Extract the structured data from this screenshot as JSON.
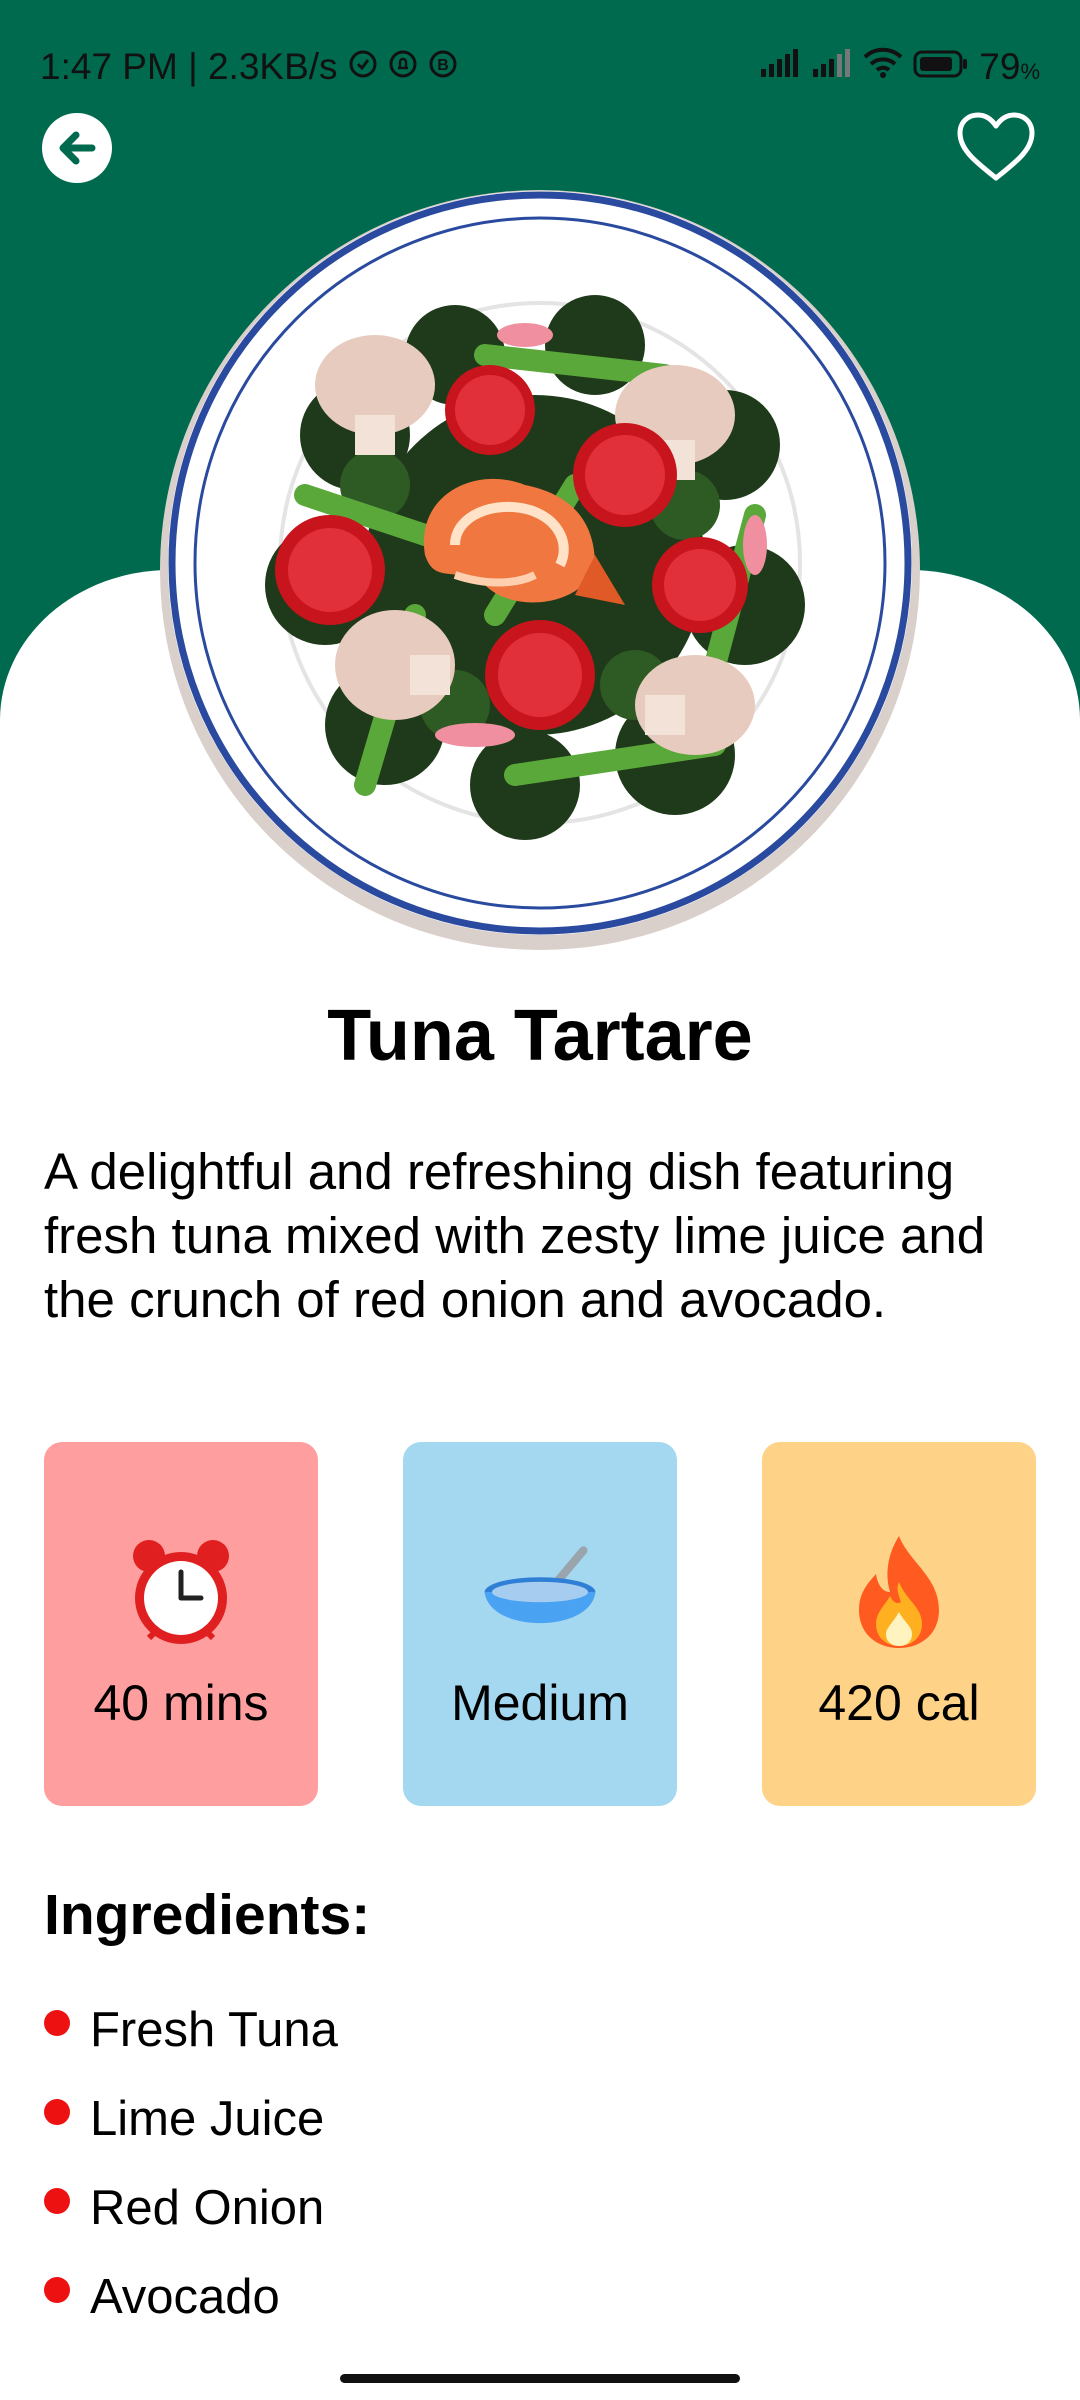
{
  "status_bar": {
    "time_and_speed": "1:47 PM | 2.3KB/s",
    "battery_percent": "79",
    "battery_unit": "%"
  },
  "header": {
    "back_icon": "arrow-left-icon",
    "favorite_icon": "heart-outline-icon"
  },
  "recipe": {
    "image_icon": "salad-bowl-illustration",
    "title": "Tuna Tartare",
    "description": "A delightful and refreshing dish featuring fresh tuna mixed with zesty lime juice and the crunch of red onion and avocado."
  },
  "info_cards": [
    {
      "icon": "alarm-clock-icon",
      "label": "40 mins",
      "color": "#ff9e9e"
    },
    {
      "icon": "bowl-spoon-icon",
      "label": "Medium",
      "color": "#a3d8f0"
    },
    {
      "icon": "fire-icon",
      "label": "420 cal",
      "color": "#ffd387"
    }
  ],
  "ingredients": {
    "heading": "Ingredients:",
    "items": [
      "Fresh Tuna",
      "Lime Juice",
      "Red Onion",
      "Avocado"
    ],
    "bullet_color": "#ee1111"
  },
  "colors": {
    "hero_green": "#006a4e"
  }
}
